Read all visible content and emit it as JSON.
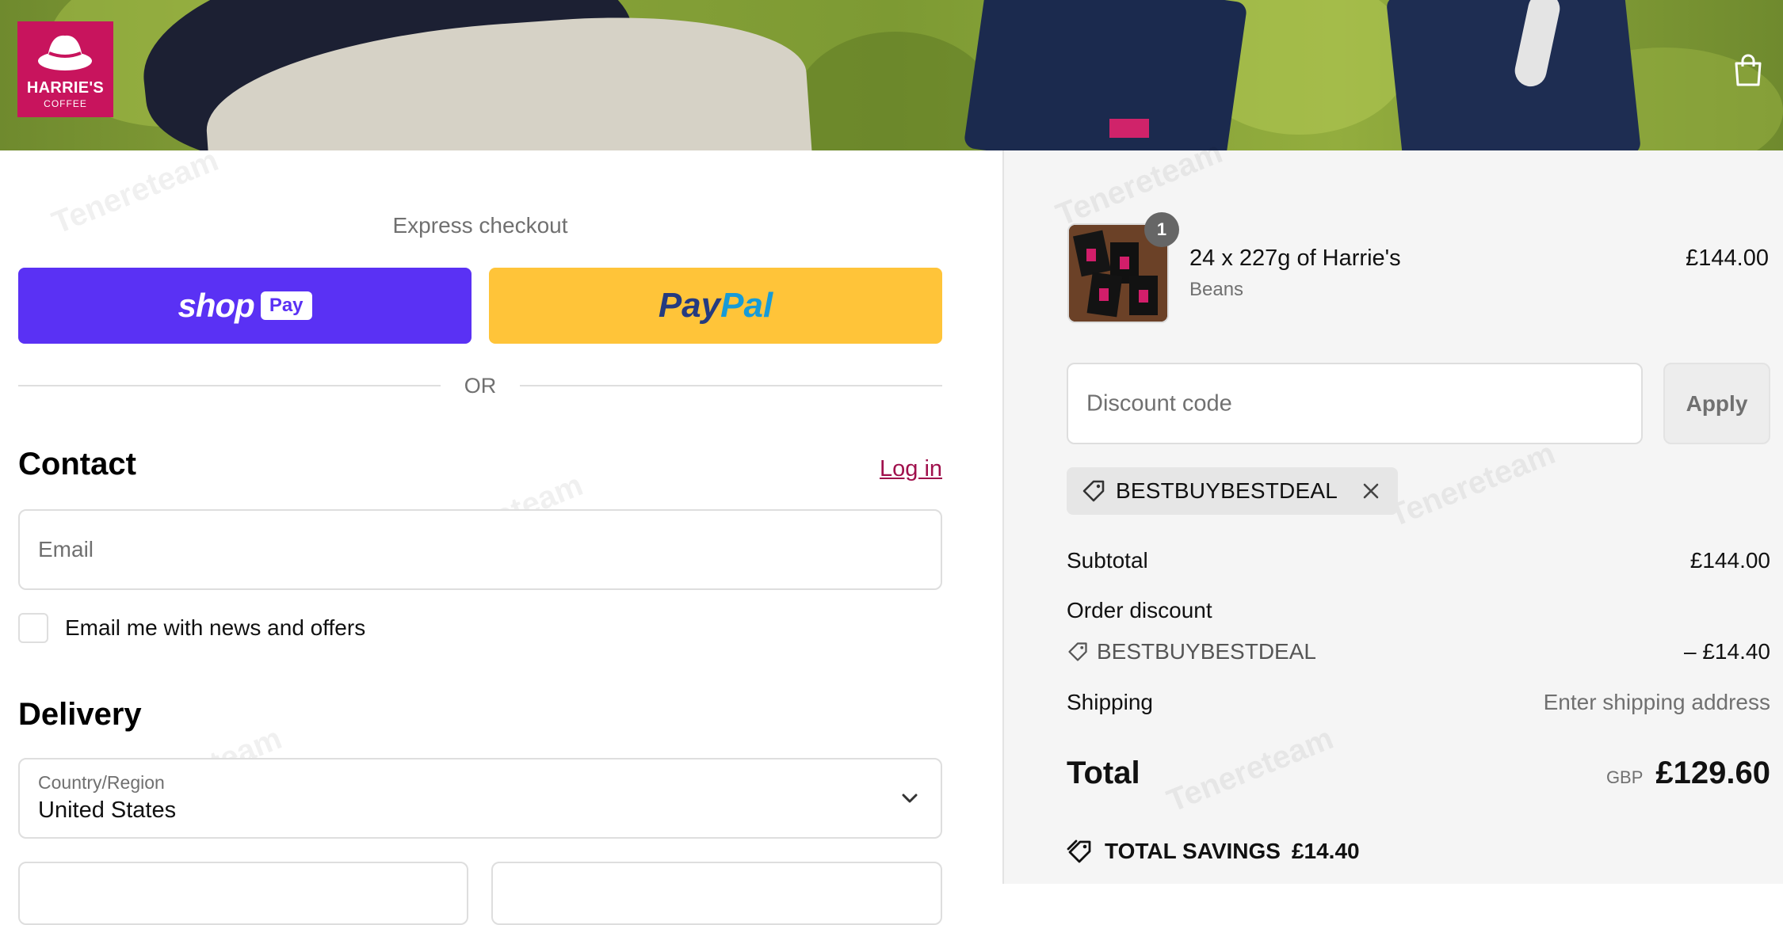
{
  "header": {
    "logo_name": "HARRIE'S",
    "logo_sub": "COFFEE"
  },
  "express": {
    "title": "Express checkout",
    "shop_word": "shop",
    "shop_pill": "Pay",
    "paypal_a": "Pay",
    "paypal_b": "Pal",
    "or": "OR"
  },
  "contact": {
    "heading": "Contact",
    "login": "Log in",
    "email_placeholder": "Email",
    "news_label": "Email me with news and offers"
  },
  "delivery": {
    "heading": "Delivery",
    "country_label": "Country/Region",
    "country_value": "United States"
  },
  "order": {
    "item": {
      "quantity_badge": "1",
      "name": "24 x 227g of Harrie's",
      "variant": "Beans",
      "price": "£144.00"
    },
    "discount_placeholder": "Discount code",
    "apply_label": "Apply",
    "applied_code": "BESTBUYBESTDEAL",
    "subtotal_label": "Subtotal",
    "subtotal_value": "£144.00",
    "order_discount_label": "Order discount",
    "discount_code": "BESTBUYBESTDEAL",
    "discount_value": "– £14.40",
    "shipping_label": "Shipping",
    "shipping_value": "Enter shipping address",
    "total_label": "Total",
    "currency": "GBP",
    "total_value": "£129.60",
    "savings_label": "TOTAL SAVINGS",
    "savings_value": "£14.40"
  },
  "watermark": "Tenereteam",
  "colors": {
    "brand": "#c8145d",
    "shop_pay": "#5a31f4",
    "paypal": "#ffc439",
    "link": "#a0104c"
  }
}
